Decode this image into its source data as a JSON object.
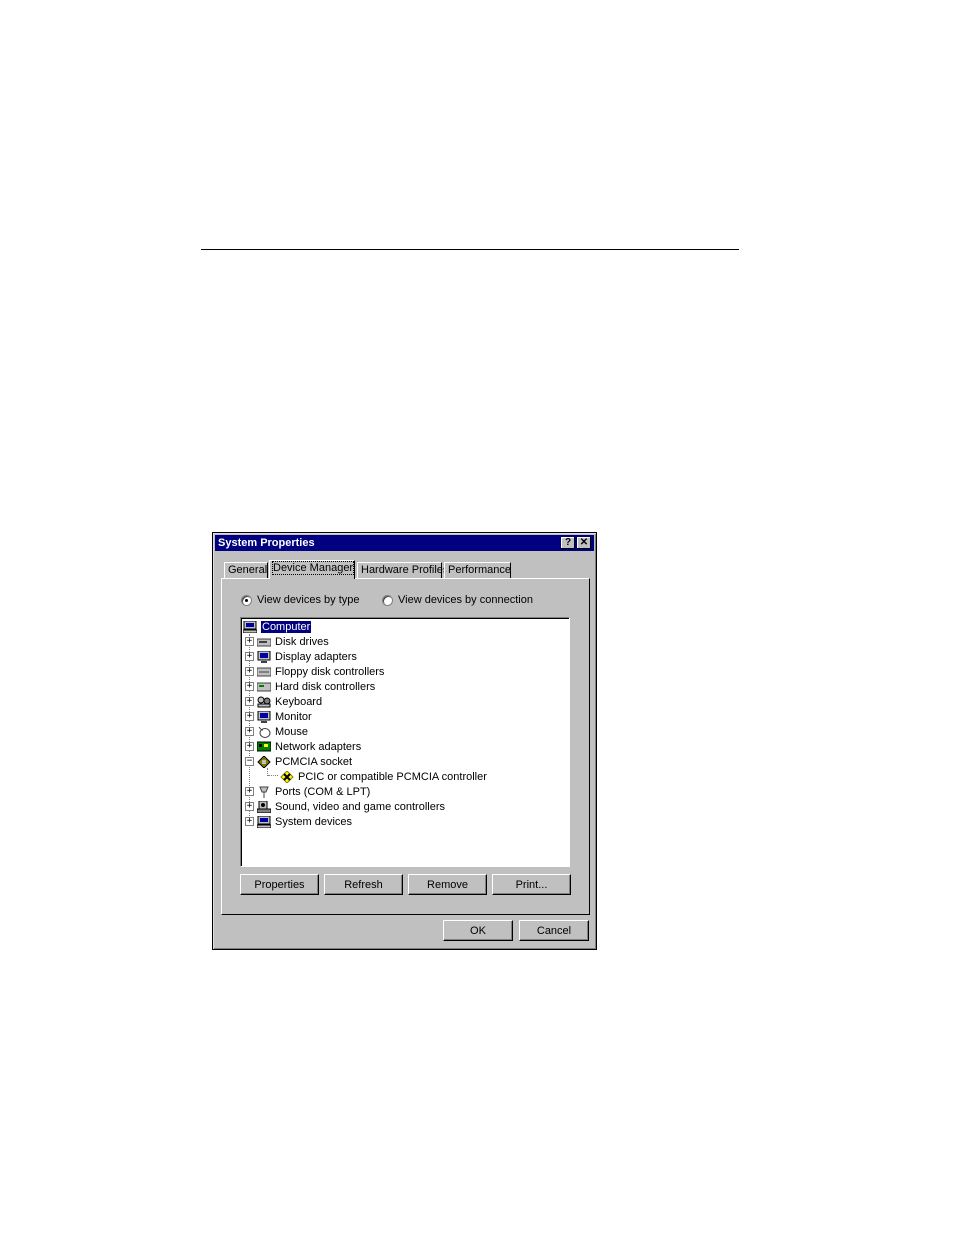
{
  "window": {
    "title": "System Properties",
    "help_button": "?",
    "close_button": "✕"
  },
  "tabs": [
    {
      "label": "General",
      "active": false
    },
    {
      "label": "Device Manager",
      "active": true
    },
    {
      "label": "Hardware Profiles",
      "active": false
    },
    {
      "label": "Performance",
      "active": false
    }
  ],
  "view_options": {
    "by_type": {
      "label": "View devices by type",
      "checked": true
    },
    "by_connection": {
      "label": "View devices by connection",
      "checked": false
    }
  },
  "tree": {
    "root": "Computer",
    "items": [
      {
        "label": "Disk drives",
        "icon": "disk-drive-icon",
        "expander": "+"
      },
      {
        "label": "Display adapters",
        "icon": "display-adapter-icon",
        "expander": "+"
      },
      {
        "label": "Floppy disk controllers",
        "icon": "floppy-controller-icon",
        "expander": "+"
      },
      {
        "label": "Hard disk controllers",
        "icon": "hard-disk-controller-icon",
        "expander": "+"
      },
      {
        "label": "Keyboard",
        "icon": "keyboard-icon",
        "expander": "+"
      },
      {
        "label": "Monitor",
        "icon": "monitor-icon",
        "expander": "+"
      },
      {
        "label": "Mouse",
        "icon": "mouse-icon",
        "expander": "+"
      },
      {
        "label": "Network adapters",
        "icon": "network-adapter-icon",
        "expander": "+"
      },
      {
        "label": "PCMCIA socket",
        "icon": "pcmcia-socket-icon",
        "expander": "−"
      },
      {
        "label": "PCIC or compatible PCMCIA controller",
        "icon": "disabled-device-icon",
        "child": true
      },
      {
        "label": "Ports (COM & LPT)",
        "icon": "ports-icon",
        "expander": "+"
      },
      {
        "label": "Sound, video and game controllers",
        "icon": "sound-controller-icon",
        "expander": "+"
      },
      {
        "label": "System devices",
        "icon": "system-devices-icon",
        "expander": "+"
      }
    ]
  },
  "buttons": {
    "properties": "Properties",
    "refresh": "Refresh",
    "remove": "Remove",
    "print": "Print...",
    "ok": "OK",
    "cancel": "Cancel"
  },
  "colors": {
    "titlebar": "#000080",
    "face": "#c0c0c0",
    "selection": "#000080"
  }
}
